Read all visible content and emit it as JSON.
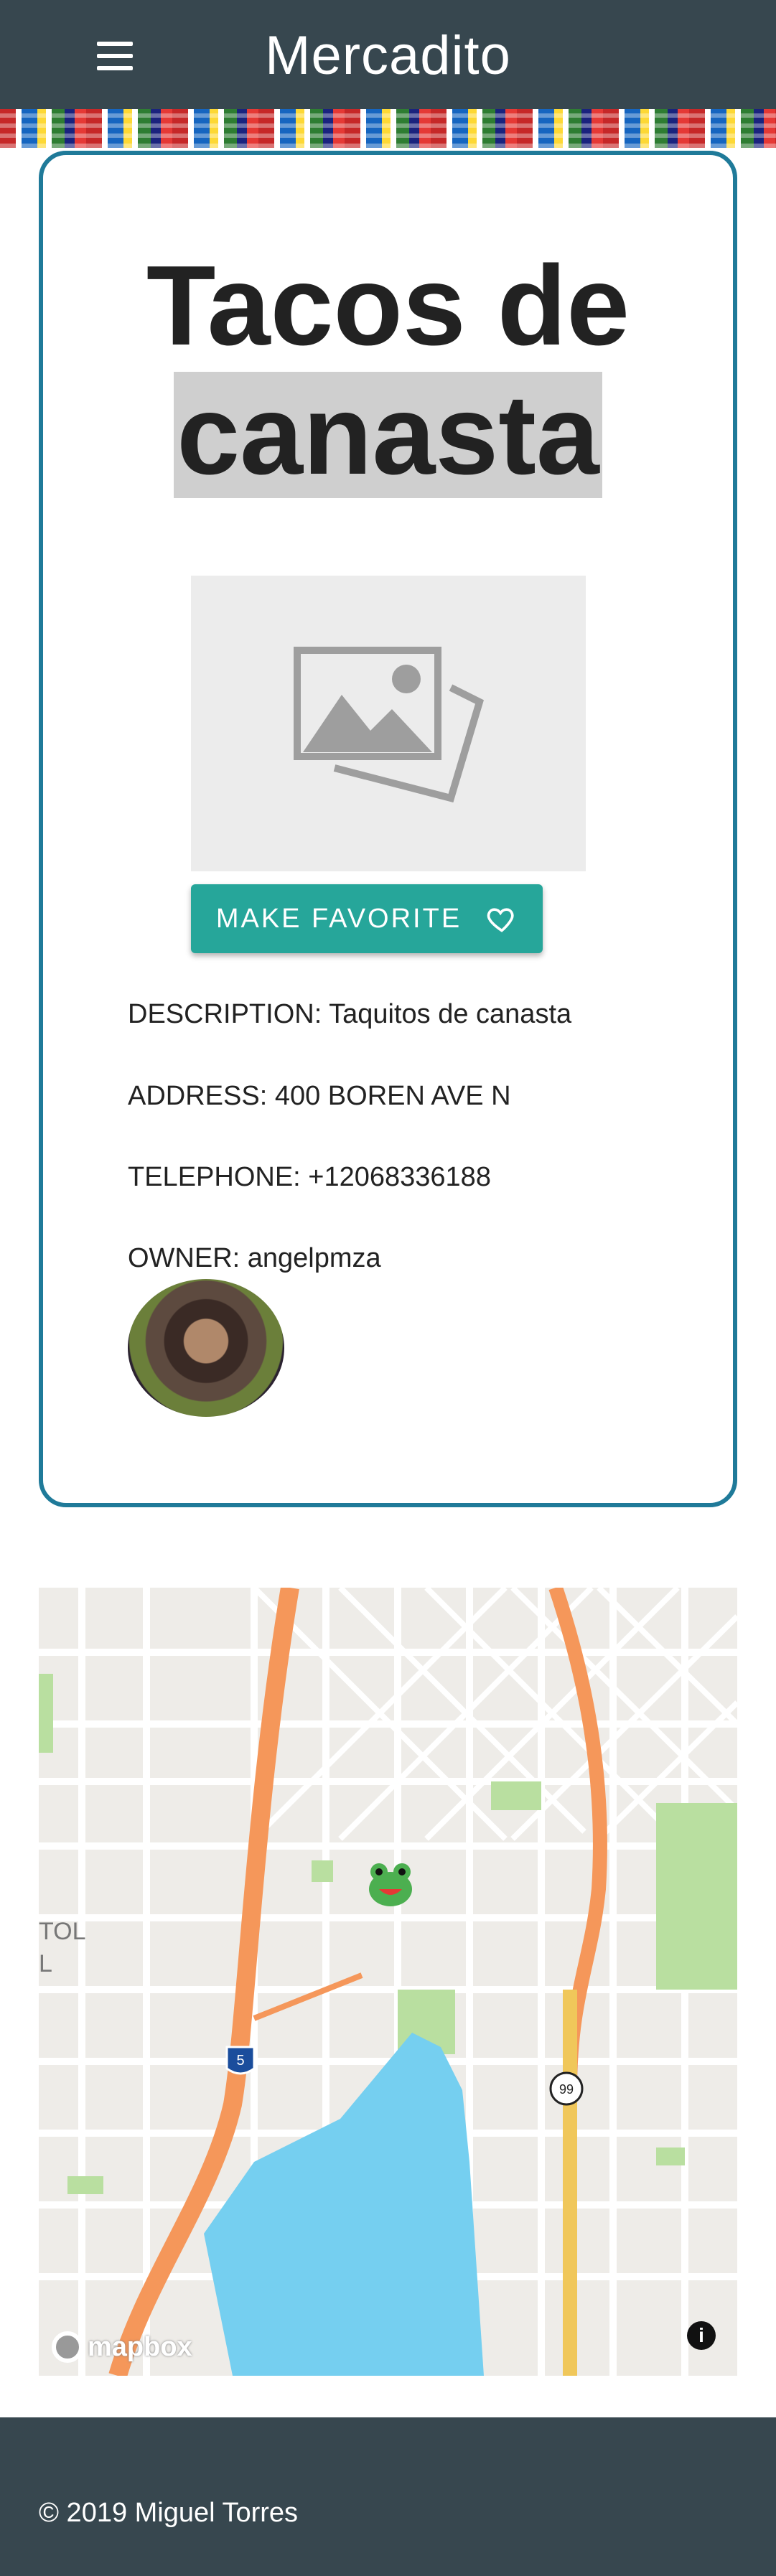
{
  "header": {
    "title": "Mercadito",
    "menu_icon": "hamburger-menu-icon",
    "background": "#37474f"
  },
  "place": {
    "title_line1": "Tacos de",
    "title_line2": "canasta",
    "photo_icon": "image-placeholder-icon",
    "favorite_button_label": "MAKE FAVORITE",
    "favorite_icon": "heart-outline-icon",
    "description": "DESCRIPTION: Taquitos de canasta",
    "address": "ADDRESS: 400 BOREN AVE N",
    "telephone": "TELEPHONE: +12068336188",
    "owner": "OWNER: angelpmza",
    "border_color": "#1f7a99",
    "button_color": "#26a69a"
  },
  "map": {
    "attribution": "mapbox",
    "label_partial_1": "TOL",
    "label_partial_2": "L",
    "highway_5": "5",
    "highway_99": "99",
    "info_icon": "info-icon",
    "marker_icon": "frog-marker-icon"
  },
  "footer": {
    "copyright": "© 2019 Miguel Torres"
  }
}
